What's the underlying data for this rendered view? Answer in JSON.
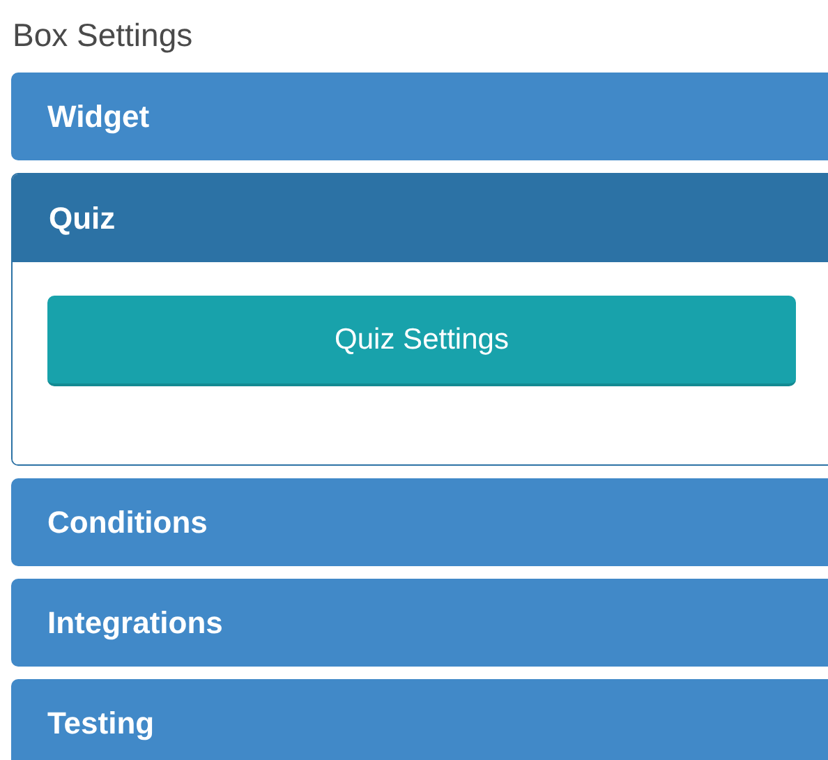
{
  "title": "Box Settings",
  "sections": [
    {
      "label": "Widget",
      "expanded": false
    },
    {
      "label": "Quiz",
      "expanded": true,
      "button": "Quiz Settings"
    },
    {
      "label": "Conditions",
      "expanded": false
    },
    {
      "label": "Integrations",
      "expanded": false
    },
    {
      "label": "Testing",
      "expanded": false
    }
  ]
}
